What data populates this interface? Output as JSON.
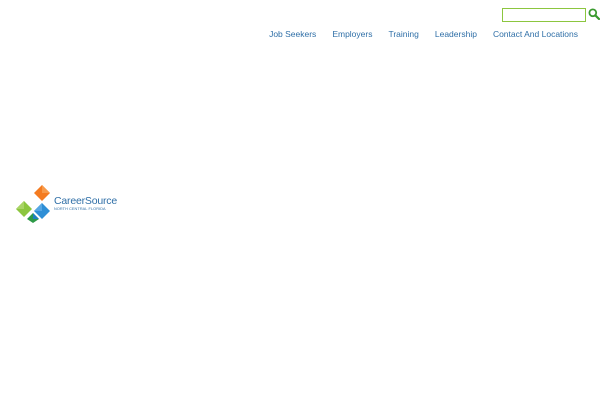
{
  "search": {
    "value": "",
    "placeholder": "",
    "icon": "search-icon"
  },
  "nav": {
    "items": [
      {
        "label": "Job Seekers"
      },
      {
        "label": "Employers"
      },
      {
        "label": "Training"
      },
      {
        "label": "Leadership"
      },
      {
        "label": "Contact And Locations"
      }
    ]
  },
  "logo": {
    "name": "CareerSource",
    "subtitle": "NORTH CENTRAL FLORIDA"
  },
  "colors": {
    "nav_text": "#2f6fa7",
    "search_border": "#8cc63f",
    "search_icon": "#3a9a2f",
    "logo_orange": "#f47b20",
    "logo_green": "#8cc63f",
    "logo_blue": "#2f8fd6",
    "logo_darkgreen": "#2e9a48"
  }
}
